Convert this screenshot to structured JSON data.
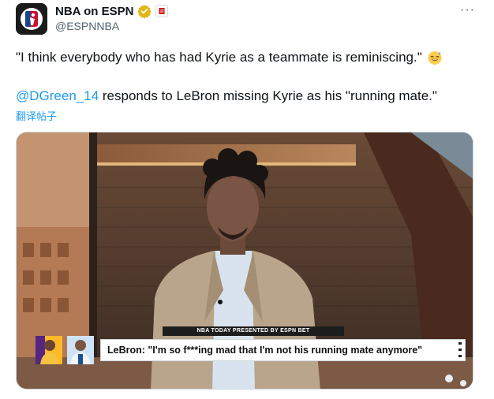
{
  "tweet": {
    "display_name": "NBA on ESPN",
    "handle": "@ESPNNBA",
    "more_label": "···",
    "quote_text": "\"I think everybody who has had Kyrie as a teammate is reminiscing.\"",
    "mention": "@DGreen_14",
    "reply_text": " responds to LeBron missing Kyrie as his \"running mate.\"",
    "translate_label": "翻译帖子"
  },
  "media": {
    "show_bar": "NBA TODAY PRESENTED BY ESPN BET",
    "caption": "LeBron: \"I'm so f***ing mad that I'm not his running mate anymore\""
  },
  "icons": {
    "avatar": "espn-nba-logo",
    "verified": "verified-badge-icon",
    "affiliate": "espn-affiliate-icon",
    "emoji": "grinning-sweat-emoji"
  },
  "colors": {
    "link": "#1d9bf0",
    "verified_gold": "#e2b719",
    "espn_red": "#d00000"
  }
}
